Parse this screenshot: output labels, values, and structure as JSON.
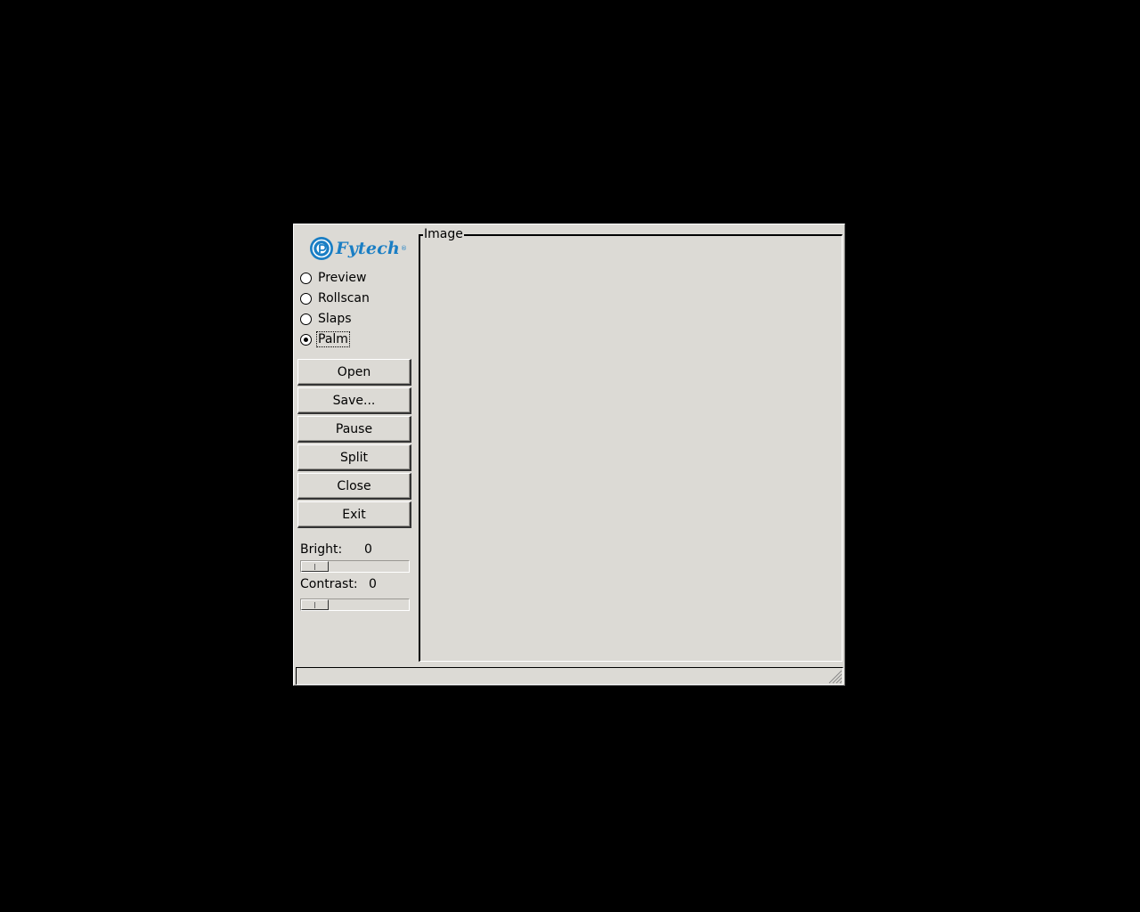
{
  "brand": {
    "name": "Fytech",
    "reg_mark": "®",
    "color": "#1a7ec4"
  },
  "modes": [
    {
      "label": "Preview",
      "checked": false
    },
    {
      "label": "Rollscan",
      "checked": false
    },
    {
      "label": "Slaps",
      "checked": false
    },
    {
      "label": "Palm",
      "checked": true
    }
  ],
  "buttons": {
    "open": "Open",
    "save": "Save...",
    "pause": "Pause",
    "split": "Split",
    "close": "Close",
    "exit": "Exit"
  },
  "bright": {
    "label": "Bright:",
    "value": "0"
  },
  "contrast": {
    "label": "Contrast:",
    "value": "0"
  },
  "image_panel": {
    "title": "Image"
  },
  "status": {
    "text": ""
  },
  "colors": {
    "window_bg": "#dcdad5",
    "desktop_bg": "#000000"
  }
}
